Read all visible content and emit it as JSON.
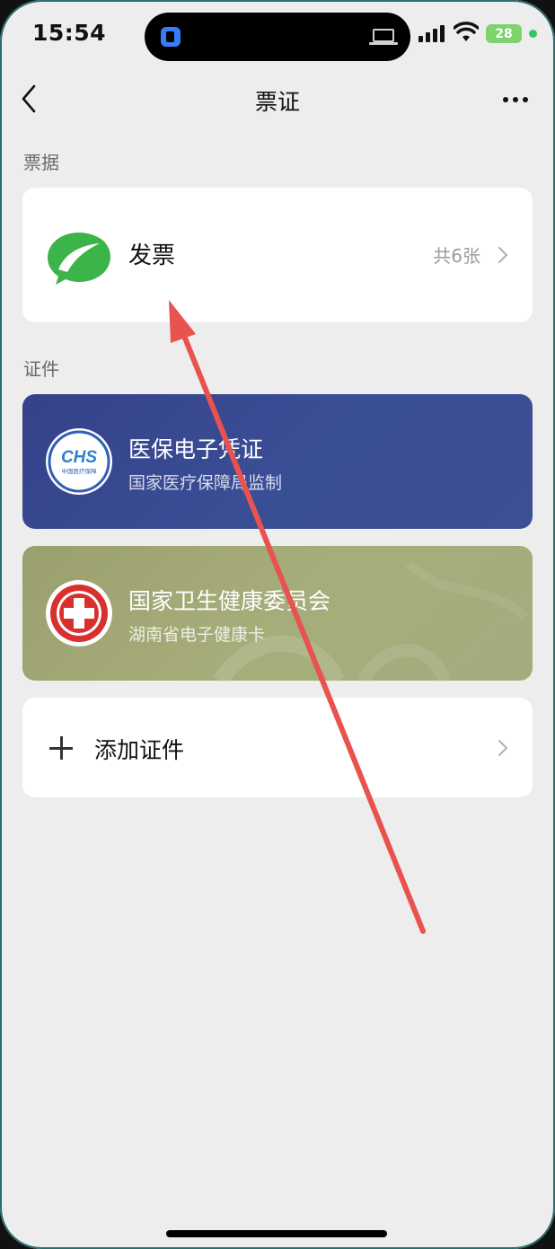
{
  "status_bar": {
    "time": "15:54",
    "battery": "28"
  },
  "nav": {
    "title": "票证"
  },
  "sections": {
    "receipts_label": "票据",
    "certificates_label": "证件"
  },
  "invoice": {
    "title": "发票",
    "count": "共6张",
    "icon": "leaf-chat-icon",
    "icon_color": "#3bb54a"
  },
  "certificates": [
    {
      "title": "医保电子凭证",
      "subtitle": "国家医疗保障局监制",
      "logo_text": "CHS",
      "logo_caption": "中国医疗保障",
      "color": "#3a4a92"
    },
    {
      "title": "国家卫生健康委员会",
      "subtitle": "湖南省电子健康卡",
      "logo": "red-cross-icon",
      "color": "#a2a876"
    }
  ],
  "add_certificate": {
    "label": "添加证件"
  },
  "annotation": {
    "arrow_color": "#e8524f"
  }
}
